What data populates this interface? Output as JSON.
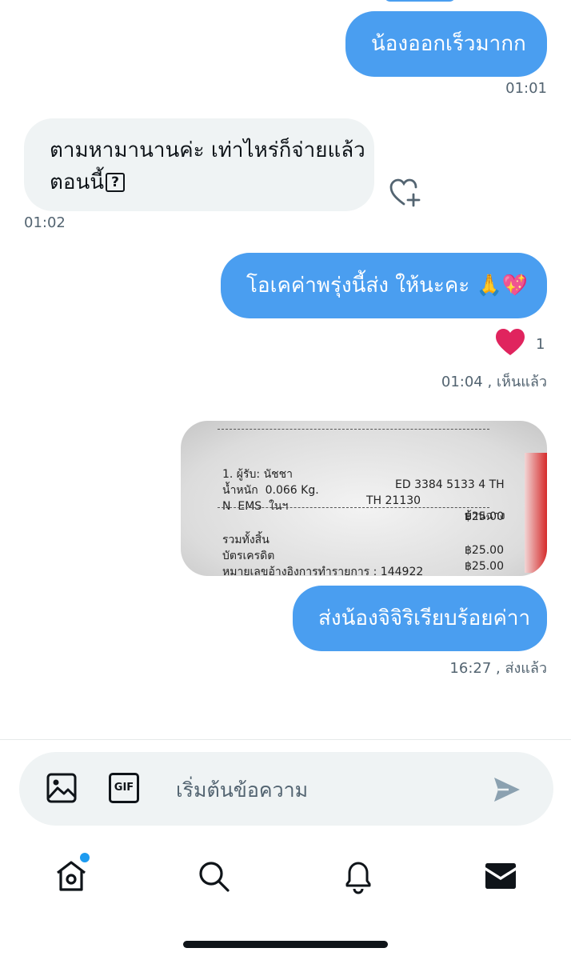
{
  "messages": [
    {
      "text": "น้องออกเร็วมากก",
      "time": "01:01"
    },
    {
      "line1": "ตามหามานานค่ะ เท่าไหร่ก็จ่ายแล้ว",
      "line2": "ตอนนี้",
      "unknown_glyph": "?",
      "time": "01:02"
    },
    {
      "text": "โอเคค่าพรุ่งนี้ส่ง ให้นะคะ 🙏💖",
      "reaction_emoji": "❤️",
      "reaction_count": "1",
      "time": "01:04",
      "status": ", เห็นแล้ว"
    },
    {
      "text": "ส่งน้องจิจิริเรียบร้อยค่าา",
      "time": "16:27",
      "status": ", ส่งแล้ว"
    }
  ],
  "receipt": {
    "dashes": "------------------------------------------------",
    "row1": [
      "1. ผู้รับ: นัชชา",
      "ED 3384 5133 4 TH",
      ""
    ],
    "row2": [
      "น้ำหนัก  0.066 Kg.",
      "TH 21130",
      "บ้านฉาง"
    ],
    "row3": [
      "N  EMS  ในฯ",
      "",
      "฿25.00"
    ],
    "row4": [
      "รวมทั้งสิ้น",
      "",
      "฿25.00"
    ],
    "row5": [
      "บัตรเครดิต",
      "",
      "฿25.00"
    ],
    "row6": "หมายเลขอ้างอิงการทำรายการ : 144922"
  },
  "composer": {
    "placeholder": "เริ่มต้นข้อความ",
    "gif_label": "GIF"
  },
  "icons": {
    "image": "image-icon",
    "gif": "gif-icon",
    "send": "send-icon",
    "home": "home-icon",
    "search": "search-icon",
    "notifications": "bell-icon",
    "messages": "envelope-icon",
    "add_reaction": "heart-plus-icon"
  },
  "colors": {
    "outgoing": "#4a9ef0",
    "incoming": "#eff3f4",
    "accent": "#1d9bf0",
    "heart": "#e0245e"
  }
}
